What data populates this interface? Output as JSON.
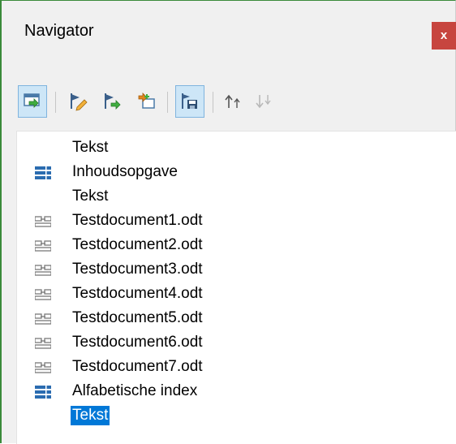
{
  "window": {
    "title": "Navigator",
    "close_label": "x"
  },
  "toolbar": {
    "buttons": [
      {
        "icon": "navigate-icon",
        "active": true
      },
      {
        "icon": "edit-icon",
        "active": false
      },
      {
        "icon": "update-icon",
        "active": false
      },
      {
        "icon": "insert-icon",
        "active": false
      },
      {
        "icon": "save-contents-icon",
        "active": true
      },
      {
        "icon": "move-up-icon",
        "active": false,
        "disabled": false
      },
      {
        "icon": "move-down-icon",
        "active": false,
        "disabled": true
      }
    ]
  },
  "tree": {
    "items": [
      {
        "label": "Tekst",
        "icon": "none"
      },
      {
        "label": "Inhoudsopgave",
        "icon": "index-icon"
      },
      {
        "label": "Tekst",
        "icon": "none"
      },
      {
        "label": "Testdocument1.odt",
        "icon": "link-icon"
      },
      {
        "label": "Testdocument2.odt",
        "icon": "link-icon"
      },
      {
        "label": "Testdocument3.odt",
        "icon": "link-icon"
      },
      {
        "label": "Testdocument4.odt",
        "icon": "link-icon"
      },
      {
        "label": "Testdocument5.odt",
        "icon": "link-icon"
      },
      {
        "label": "Testdocument6.odt",
        "icon": "link-icon"
      },
      {
        "label": "Testdocument7.odt",
        "icon": "link-icon"
      },
      {
        "label": "Alfabetische index",
        "icon": "index-icon"
      },
      {
        "label": "Tekst",
        "icon": "none",
        "selected": true
      }
    ]
  },
  "colors": {
    "accent": "#0078d7",
    "close": "#c7453f",
    "active_button": "#cde6f7",
    "index_icon": "#2b6cb0"
  }
}
